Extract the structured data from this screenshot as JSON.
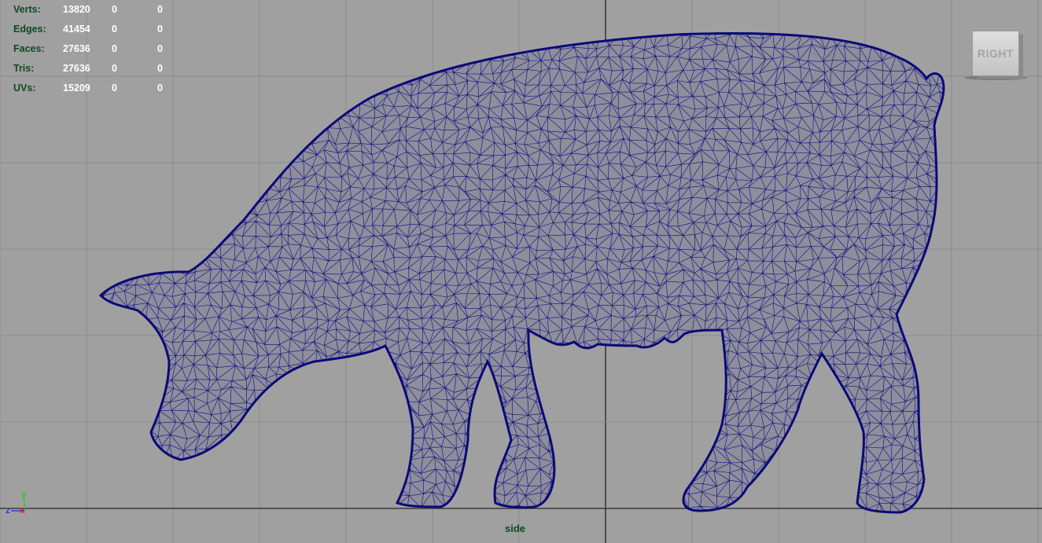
{
  "hud": {
    "rows": [
      {
        "label": "Verts:",
        "v1": "13820",
        "v2": "0",
        "v3": "0"
      },
      {
        "label": "Edges:",
        "v1": "41454",
        "v2": "0",
        "v3": "0"
      },
      {
        "label": "Faces:",
        "v1": "27636",
        "v2": "0",
        "v3": "0"
      },
      {
        "label": "Tris:",
        "v1": "27636",
        "v2": "0",
        "v3": "0"
      },
      {
        "label": "UVs:",
        "v1": "15209",
        "v2": "0",
        "v3": "0"
      }
    ]
  },
  "viewcube": {
    "label": "RIGHT"
  },
  "camera": {
    "name": "side"
  },
  "axis_gizmo": {
    "y_label": "y",
    "z_label": "z",
    "x_label": "x"
  },
  "colors": {
    "background": "#a0a0a0",
    "grid": "#8b8b8b",
    "grid_axis": "#3a3a3a",
    "wireframe": "#0c0c80",
    "mesh_fill": "#8e8e9c",
    "hud_label": "#0c4a22",
    "hud_value": "#ffffff",
    "axis_x": "#d42a1a",
    "axis_y": "#2cc23a",
    "axis_z": "#2a3fd6"
  },
  "icons": {
    "axis_gizmo": "xyz-axis-icon",
    "model": "pig-wireframe-mesh"
  }
}
